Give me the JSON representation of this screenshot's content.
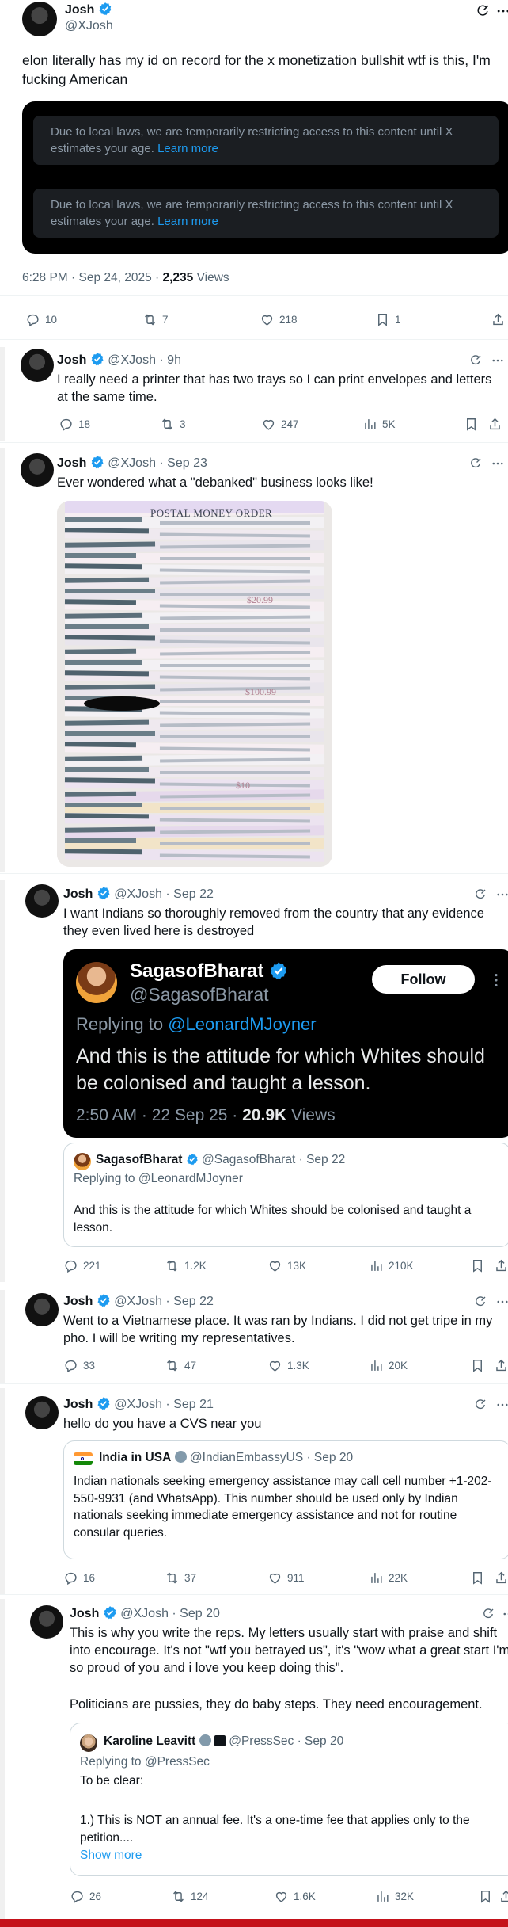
{
  "main_tweet": {
    "name": "Josh",
    "handle": "@XJosh",
    "text": "elon literally has my id on record for the x monetization bullshit wtf is this, I'm fucking American",
    "restricted_notice": "Due to local laws, we are temporarily restricting access to this content until X estimates your age.",
    "learn_more": "Learn more",
    "time": "6:28 PM · Sep 24, 2025 · ",
    "views_count": "2,235",
    "views_label": " Views",
    "replies": "10",
    "reposts": "7",
    "likes": "218",
    "bookmarks": "1"
  },
  "tweets": [
    {
      "name": "Josh",
      "handle": "@XJosh · 9h",
      "text": "I really need a printer that has two trays so I can print envelopes and letters at the same time.",
      "replies": "18",
      "reposts": "3",
      "likes": "247",
      "views": "5K"
    },
    {
      "name": "Josh",
      "handle": "@XJosh · Sep 23",
      "text": "Ever wondered what a \"debanked\" business looks like!",
      "image_labels": [
        "POSTAL MONEY ORDER",
        "$100.99",
        "$20.99",
        "$10"
      ]
    },
    {
      "name": "Josh",
      "handle": "@XJosh · Sep 22",
      "text": "I want Indians so thoroughly removed from the country that any evidence they even lived here is destroyed",
      "embed": {
        "name": "SagasofBharat",
        "handle": "@SagasofBharat",
        "follow": "Follow",
        "replying_to": "Replying to ",
        "replying_handle": "@LeonardMJoyner",
        "text": "And this is the attitude for which Whites should be colonised and taught a lesson.",
        "time": "2:50 AM · 22 Sep 25 · ",
        "views_count": "20.9K",
        "views_label": " Views"
      },
      "quote": {
        "name": "SagasofBharat",
        "handle": "@SagasofBharat · Sep 22",
        "replying": "Replying to @LeonardMJoyner",
        "text": "And this is the attitude for which Whites should be colonised and taught a lesson."
      },
      "replies": "221",
      "reposts": "1.2K",
      "likes": "13K",
      "views": "210K"
    },
    {
      "name": "Josh",
      "handle": "@XJosh · Sep 22",
      "text": "Went to a Vietnamese place. It was ran by Indians. I did not get tripe in my pho. I will be writing my representatives.",
      "replies": "33",
      "reposts": "47",
      "likes": "1.3K",
      "views": "20K"
    },
    {
      "name": "Josh",
      "handle": "@XJosh · Sep 21",
      "text": "hello do you have a CVS near you",
      "quote": {
        "name": "India in USA",
        "handle": "@IndianEmbassyUS · Sep 20",
        "text": "Indian nationals seeking emergency assistance may call cell number +1-202-550-9931 (and WhatsApp). This number should be used only by Indian nationals seeking immediate emergency assistance and not for routine consular queries."
      },
      "replies": "16",
      "reposts": "37",
      "likes": "911",
      "views": "22K"
    },
    {
      "name": "Josh",
      "handle": "@XJosh · Sep 20",
      "text": "This is why you write the reps. My letters usually start with praise and shift into encourage. It's not \"wtf you betrayed us\", it's \"wow what a great start I'm so proud of you and i love you keep doing this\".",
      "text2": "Politicians are pussies, they do baby steps. They need encouragement.",
      "quote": {
        "name": "Karoline Leavitt",
        "handle": "@PressSec · Sep 20",
        "replying": "Replying to @PressSec",
        "line1": "To be clear:",
        "line2": "1.) This is NOT an annual fee. It's a one-time fee that applies only to the petition....",
        "show_more": "Show more"
      },
      "replies": "26",
      "reposts": "124",
      "likes": "1.6K",
      "views": "32K"
    }
  ],
  "colors": {
    "accent": "#1d9bf0",
    "text": "#0f1419",
    "muted": "#536471",
    "bottom_bar": "#c4121a"
  }
}
